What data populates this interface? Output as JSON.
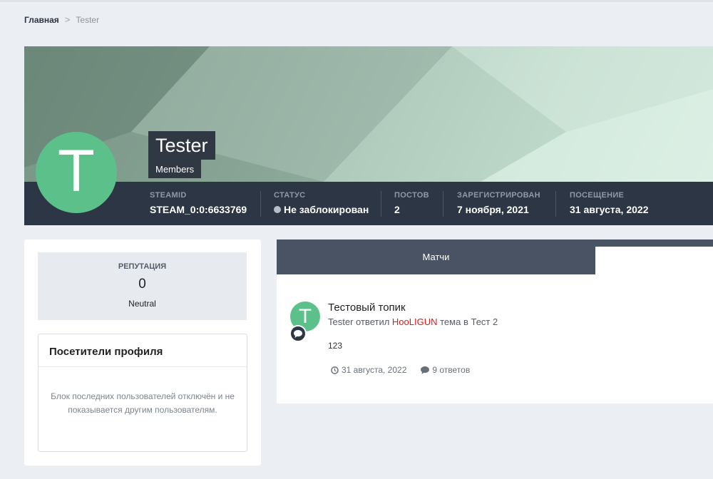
{
  "breadcrumb": {
    "home": "Главная",
    "separator": ">",
    "current": "Tester"
  },
  "profile": {
    "avatar_letter": "T",
    "name": "Tester",
    "group": "Members",
    "avatar_color": "#5cc08a"
  },
  "stats": [
    {
      "label": "STEAMID",
      "value": "STEAM_0:0:6633769"
    },
    {
      "label": "СТАТУС",
      "value": "Не заблокирован"
    },
    {
      "label": "ПОСТОВ",
      "value": "2"
    },
    {
      "label": "ЗАРЕГИСТРИРОВАН",
      "value": "7 ноября, 2021"
    },
    {
      "label": "ПОСЕЩЕНИЕ",
      "value": "31 августа, 2022"
    }
  ],
  "reputation": {
    "label": "РЕПУТАЦИЯ",
    "value": "0",
    "level": "Neutral"
  },
  "visitors": {
    "title": "Посетители профиля",
    "message": "Блок последних пользователей отключён и не показывается другим пользователям."
  },
  "tabs": {
    "active_label": "Матчи"
  },
  "post": {
    "avatar_letter": "T",
    "title": "Тестовый топик",
    "author": "Tester",
    "verb": "ответил",
    "user": "HooLIGUN",
    "topic_word": "тема в",
    "forum": "Тест 2",
    "body": "123",
    "date": "31 августа, 2022",
    "replies": "9 ответов"
  },
  "colors": {
    "infobar": "#2d3644",
    "accent_user": "#e01919"
  }
}
